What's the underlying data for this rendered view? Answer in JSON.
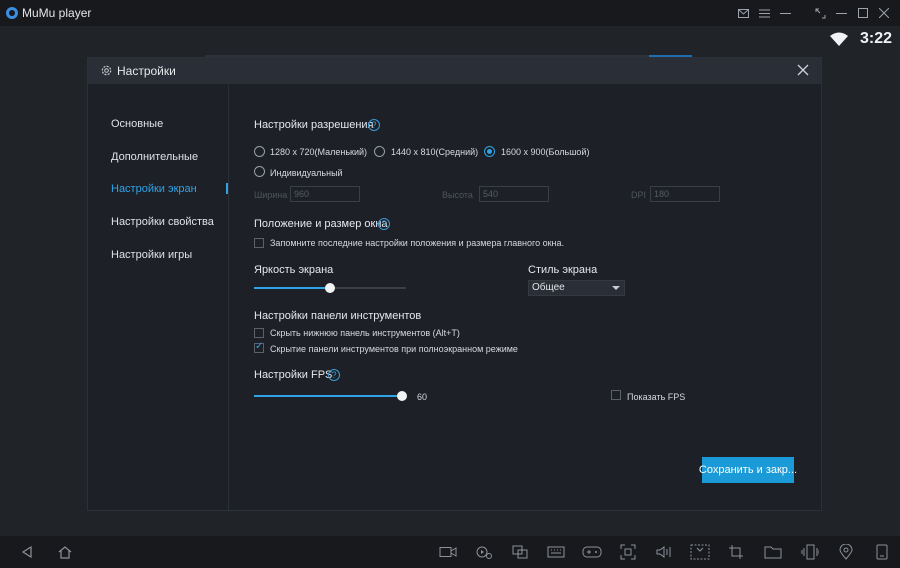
{
  "app": {
    "title": "MuMu player"
  },
  "status": {
    "clock": "3:22"
  },
  "dialog": {
    "title": "Настройки",
    "sidebar": {
      "items": [
        {
          "label": "Основные"
        },
        {
          "label": "Дополнительные"
        },
        {
          "label": "Настройки экран"
        },
        {
          "label": "Настройки свойства"
        },
        {
          "label": "Настройки игры"
        }
      ],
      "active_index": 2
    },
    "resolution": {
      "title": "Настройки разрешения",
      "options": [
        {
          "label": "1280 x 720(Маленький)",
          "selected": false
        },
        {
          "label": "1440 x 810(Средний)",
          "selected": false
        },
        {
          "label": "1600 x 900(Большой)",
          "selected": true
        },
        {
          "label": "Индивидуальный",
          "selected": false
        }
      ],
      "width_label": "Ширина",
      "width_value": "960",
      "height_label": "Высота",
      "height_value": "540",
      "dpi_label": "DPI",
      "dpi_value": "180"
    },
    "window": {
      "title": "Положение и размер окна",
      "remember_label": "Запомните последние настройки положения и размера главного окна.",
      "remember_checked": false
    },
    "brightness": {
      "title": "Яркость экрана",
      "level_percent": 50
    },
    "style": {
      "title": "Стиль экрана",
      "selected": "Общее"
    },
    "toolbar": {
      "title": "Настройки панели инструментов",
      "hide_bottom_label": "Скрыть нижнюю панель инструментов (Alt+T)",
      "hide_bottom_checked": false,
      "hide_fullscreen_label": "Скрытие панели инструментов при полноэкранном режиме",
      "hide_fullscreen_checked": true
    },
    "fps": {
      "title": "Настройки FPS",
      "value": "60",
      "level_percent": 100,
      "show_fps_label": "Показать FPS",
      "show_fps_checked": false
    },
    "save_label": "Сохранить и закр..."
  },
  "colors": {
    "accent": "#2fa3e6",
    "button": "#1a9ad6",
    "dialog_bg": "#1d2027",
    "header_bg": "#2a2e36"
  }
}
